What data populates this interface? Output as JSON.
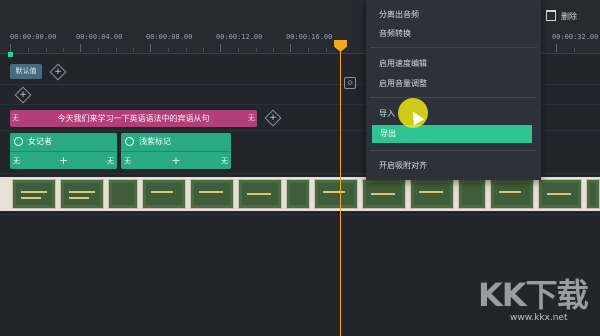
{
  "ruler": {
    "ticks": [
      "00:00:00.00",
      "00:00:04.00",
      "00:00:08.00",
      "00:00:12.00",
      "00:00:16.00",
      "00:00:32.00"
    ]
  },
  "toolbar": {
    "delete_label": "删除"
  },
  "tracks": {
    "default_clip": "默认值",
    "subtitle": {
      "left_edge": "无",
      "text": "今天我们来学习一下英语语法中的宾语从句",
      "right_edge": "无"
    },
    "anim_clips": [
      {
        "label": "女记者",
        "left_edge": "无",
        "right_edge": "无",
        "plus": "+"
      },
      {
        "label": "浅紫标记",
        "left_edge": "无",
        "right_edge": "无",
        "plus": "+"
      }
    ]
  },
  "context_menu": {
    "items": [
      {
        "label": "分离出音频"
      },
      {
        "label": "音频转换"
      },
      {
        "label": "启用速度编辑"
      },
      {
        "label": "启用音量调整"
      },
      {
        "label": "导入"
      },
      {
        "label": "导出"
      },
      {
        "label": "开启吸附对齐"
      }
    ],
    "active_index": 5
  },
  "colors": {
    "accent": "#2fc592",
    "playhead": "#f5a623",
    "subtitle": "#b1407a",
    "anim": "#2aa985"
  },
  "watermark": {
    "text": "KK下载",
    "url": "www.kkx.net"
  }
}
